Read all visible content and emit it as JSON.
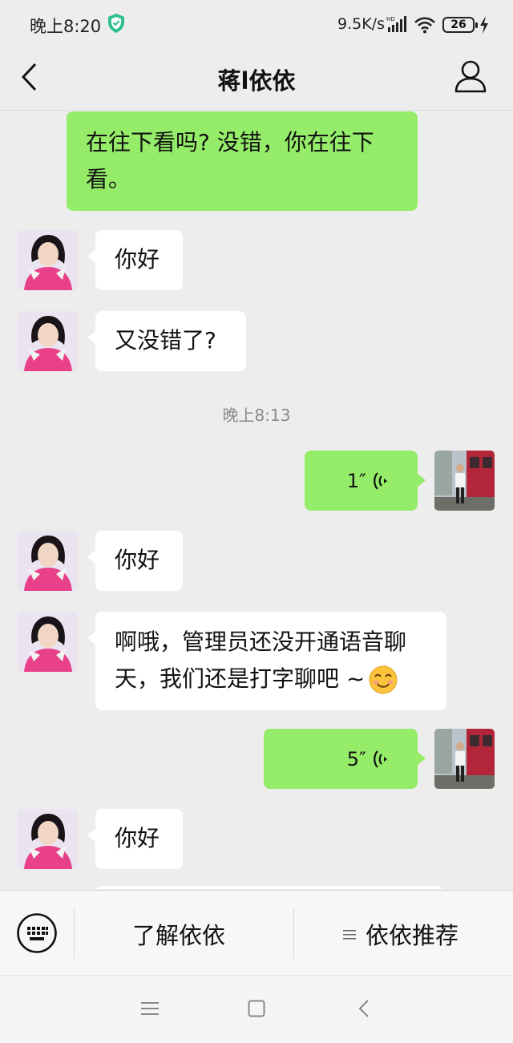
{
  "status_bar": {
    "time": "晚上8:20",
    "net_speed": "9.5K/s",
    "network_badge": "HD",
    "battery": "26"
  },
  "nav": {
    "title": "蒋l依依",
    "back_icon": "chevron-left-icon",
    "profile_icon": "person-icon"
  },
  "messages": [
    {
      "side": "out",
      "type": "text",
      "lines": [
        "在往下看吗? 没错，你在往下",
        "看。"
      ]
    },
    {
      "side": "in",
      "type": "text",
      "text": "你好"
    },
    {
      "side": "in",
      "type": "text",
      "text": "又没错了?"
    },
    {
      "type": "timestamp",
      "text": "晚上8:13"
    },
    {
      "side": "out",
      "type": "voice",
      "duration": "1″"
    },
    {
      "side": "in",
      "type": "text",
      "text": "你好"
    },
    {
      "side": "in",
      "type": "text",
      "lines": [
        "啊哦，管理员还没开通语音聊",
        "天，我们还是打字聊吧 ~"
      ],
      "emoji": "smiling-face-emoji"
    },
    {
      "side": "out",
      "type": "voice",
      "duration": "5″"
    },
    {
      "side": "in",
      "type": "text",
      "text": "你好"
    }
  ],
  "bottom_menu": {
    "keyboard_icon": "keyboard-icon",
    "item_1": "了解依依",
    "item_2": "依依推荐"
  },
  "colors": {
    "outgoing_bubble": "#95ec69",
    "incoming_bubble": "#ffffff",
    "background": "#ededed"
  }
}
